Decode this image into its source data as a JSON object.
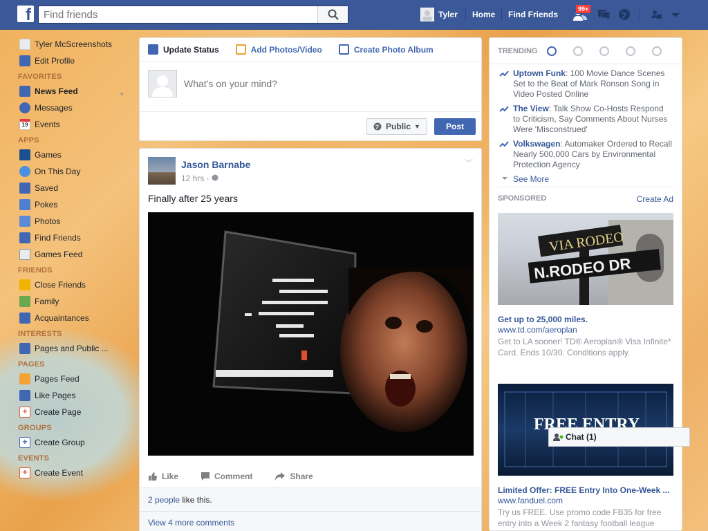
{
  "topbar": {
    "logo_glyph": "f",
    "search_placeholder": "Find friends",
    "user": "Tyler",
    "home": "Home",
    "find_friends": "Find Friends",
    "friend_requests_badge": "99+",
    "brand_color": "#3b5998"
  },
  "sidebar": {
    "profile": [
      {
        "label": "Tyler McScreenshots",
        "icon": "user-avatar-icon"
      },
      {
        "label": "Edit Profile",
        "icon": "pencil-icon"
      }
    ],
    "favorites_header": "FAVORITES",
    "favorites": [
      {
        "label": "News Feed",
        "icon": "news-feed-icon"
      },
      {
        "label": "Messages",
        "icon": "messages-icon"
      },
      {
        "label": "Events",
        "icon": "calendar-icon",
        "glyph": "19"
      }
    ],
    "apps_header": "APPS",
    "apps": [
      {
        "label": "Games",
        "icon": "games-icon"
      },
      {
        "label": "On This Day",
        "icon": "clock-icon"
      },
      {
        "label": "Saved",
        "icon": "bookmark-icon"
      },
      {
        "label": "Pokes",
        "icon": "poke-icon"
      },
      {
        "label": "Photos",
        "icon": "photos-icon"
      },
      {
        "label": "Find Friends",
        "icon": "find-friends-icon"
      },
      {
        "label": "Games Feed",
        "icon": "gamepad-icon"
      }
    ],
    "friends_header": "FRIENDS",
    "friends": [
      {
        "label": "Close Friends",
        "icon": "star-list-icon"
      },
      {
        "label": "Family",
        "icon": "family-icon"
      },
      {
        "label": "Acquaintances",
        "icon": "acquaintances-icon"
      }
    ],
    "interests_header": "INTERESTS",
    "interests": [
      {
        "label": "Pages and Public ...",
        "icon": "rss-icon"
      }
    ],
    "pages_header": "PAGES",
    "pages": [
      {
        "label": "Pages Feed",
        "icon": "flag-icon"
      },
      {
        "label": "Like Pages",
        "icon": "thumbs-up-icon"
      },
      {
        "label": "Create Page",
        "icon": "plus-icon"
      }
    ],
    "groups_header": "GROUPS",
    "groups": [
      {
        "label": "Create Group",
        "icon": "plus-icon"
      }
    ],
    "events_header": "EVENTS",
    "events": [
      {
        "label": "Create Event",
        "icon": "plus-icon"
      }
    ]
  },
  "composer": {
    "tabs": [
      "Update Status",
      "Add Photos/Video",
      "Create Photo Album"
    ],
    "placeholder": "What's on your mind?",
    "audience": "Public",
    "post_button": "Post"
  },
  "post": {
    "author": "Jason Barnabe",
    "time": "12 hrs · ",
    "text": "Finally after 25 years",
    "actions": [
      "Like",
      "Comment",
      "Share"
    ],
    "likes_link": "2 people",
    "likes_suffix": " like this.",
    "view_more_comments": "View 4 more comments"
  },
  "trending": {
    "title": "TRENDING",
    "items": [
      {
        "name": "Uptown Funk",
        "desc": ": 100 Movie Dance Scenes Set to the Beat of Mark Ronson Song in Video Posted Online"
      },
      {
        "name": "The View",
        "desc": ": Talk Show Co-Hosts Respond to Criticism, Say Comments About Nurses Were 'Misconstrued'"
      },
      {
        "name": "Volkswagen",
        "desc": ": Automaker Ordered to Recall Nearly 500,000 Cars by Environmental Protection Agency"
      }
    ],
    "see_more": "See More"
  },
  "sponsored": {
    "title": "SPONSORED",
    "create_ad": "Create Ad",
    "ads": [
      {
        "image_text_1": "VIA RODEO",
        "image_text_2": "N.RODEO DR",
        "title": "Get up to 25,000 miles.",
        "url": "www.td.com/aeroplan",
        "desc": "Get to LA sooner! TD® Aeroplan® Visa Infinite* Card. Ends 10/30. Conditions apply."
      },
      {
        "image_text_1": "FREE ENTRY",
        "title": "Limited Offer: FREE Entry Into One-Week ...",
        "url": "www.fanduel.com",
        "desc": "Try us FREE. Use promo code FB35 for free entry into a Week 2 fantasy football league"
      }
    ]
  },
  "chat": {
    "label": "Chat (1)"
  }
}
